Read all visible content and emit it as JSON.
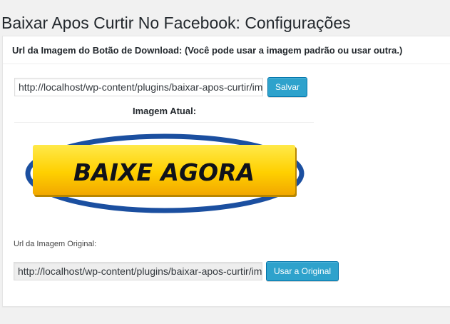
{
  "page": {
    "title": "Baixar Apos Curtir No Facebook: Configurações"
  },
  "postbox": {
    "title": "Url da Imagem do Botão de Download: (Você pode usar a imagem padrão ou usar outra.)",
    "url_value": "http://localhost/wp-content/plugins/baixar-apos-curtir/imagens/baixe-agora.png",
    "save_label": "Salvar",
    "current_image_label": "Imagem Atual:",
    "banner_text": "BAIXE AGORA",
    "original_url_label": "Url da Imagem Original:",
    "original_url_value": "http://localhost/wp-content/plugins/baixar-apos-curtir/imagens/baixe-agora.png",
    "use_original_label": "Usar a Original"
  },
  "colors": {
    "button_bg": "#2ea2cc",
    "banner_yellow": "#ffd400",
    "banner_ring_blue": "#1b4fa0"
  }
}
